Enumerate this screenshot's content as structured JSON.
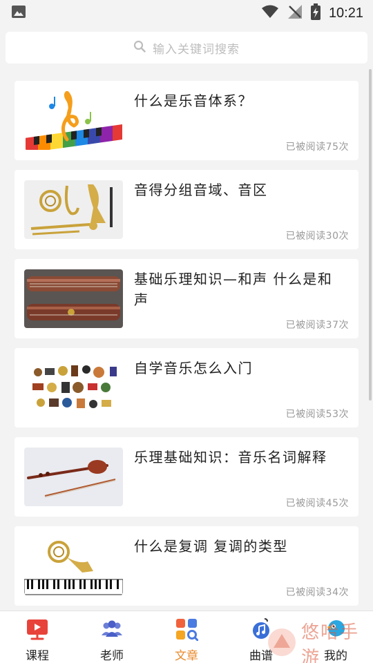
{
  "status_bar": {
    "time": "10:21",
    "icons": [
      "image-icon",
      "wifi-icon",
      "no-signal-icon",
      "battery-charging-icon"
    ]
  },
  "search": {
    "placeholder": "输入关键词搜索"
  },
  "articles": [
    {
      "title": "什么是乐音体系？",
      "reads": "已被阅读75次",
      "thumb": "rainbow-keyboard-clef-image"
    },
    {
      "title": "音得分组音域、音区",
      "reads": "已被阅读30次",
      "thumb": "brass-instruments-image"
    },
    {
      "title": "基础乐理知识—和声 什么是和声",
      "reads": "已被阅读37次",
      "thumb": "guzheng-image"
    },
    {
      "title": "自学音乐怎么入门",
      "reads": "已被阅读53次",
      "thumb": "instruments-collage-image"
    },
    {
      "title": "乐理基础知识：音乐名词解释",
      "reads": "已被阅读45次",
      "thumb": "erhu-image"
    },
    {
      "title": "什么是复调 复调的类型",
      "reads": "已被阅读34次",
      "thumb": "french-horn-piano-image"
    }
  ],
  "nav": {
    "items": [
      {
        "label": "课程",
        "icon": "video-play-icon"
      },
      {
        "label": "老师",
        "icon": "people-icon"
      },
      {
        "label": "文章",
        "icon": "grid-search-icon",
        "active": true
      },
      {
        "label": "曲谱",
        "icon": "music-sheet-icon"
      },
      {
        "label": "我的",
        "icon": "bird-avatar-icon"
      }
    ],
    "active_color": "#e98a2b"
  },
  "watermark": {
    "text": "悠哈手游"
  }
}
